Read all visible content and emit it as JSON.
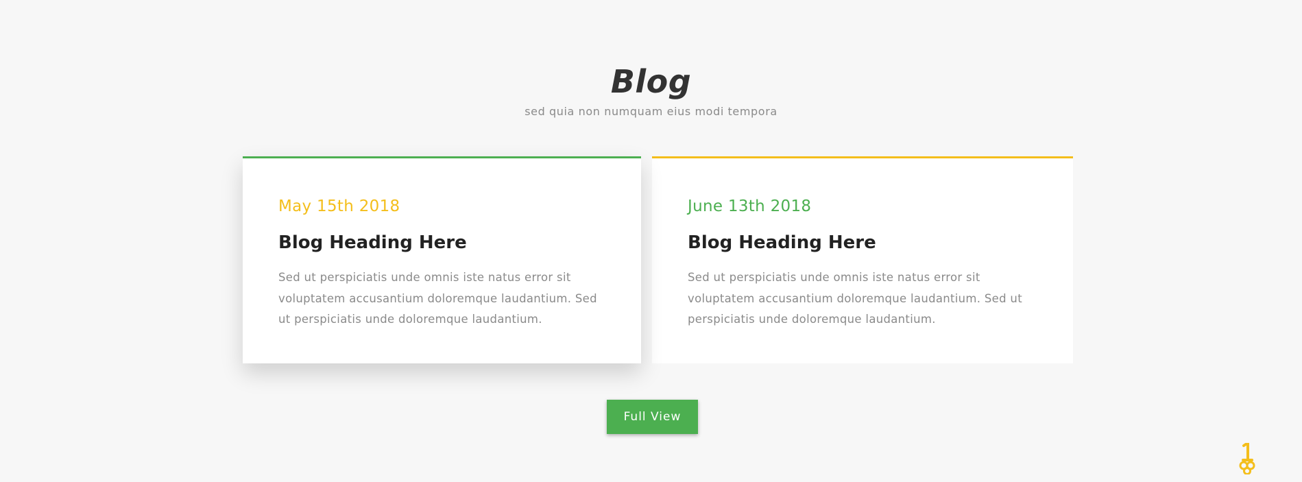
{
  "section": {
    "title": "Blog",
    "subtitle": "sed quia non numquam eius modi tempora"
  },
  "posts": [
    {
      "date": "May 15th 2018",
      "heading": "Blog Heading Here",
      "excerpt": "Sed ut perspiciatis unde omnis iste natus error sit voluptatem accusantium doloremque laudantium. Sed ut perspiciatis unde doloremque laudantium.",
      "accent_color": "#4caf50",
      "date_color": "#f4be1b"
    },
    {
      "date": "June 13th 2018",
      "heading": "Blog Heading Here",
      "excerpt": "Sed ut perspiciatis unde omnis iste natus error sit voluptatem accusantium doloremque laudantium. Sed ut perspiciatis unde doloremque laudantium.",
      "accent_color": "#f4be1b",
      "date_color": "#4caf50"
    }
  ],
  "actions": {
    "full_view_label": "Full View"
  },
  "icons": {
    "corner": "key-icon"
  },
  "colors": {
    "background": "#f7f7f7",
    "green": "#4caf50",
    "yellow": "#f4be1b"
  }
}
